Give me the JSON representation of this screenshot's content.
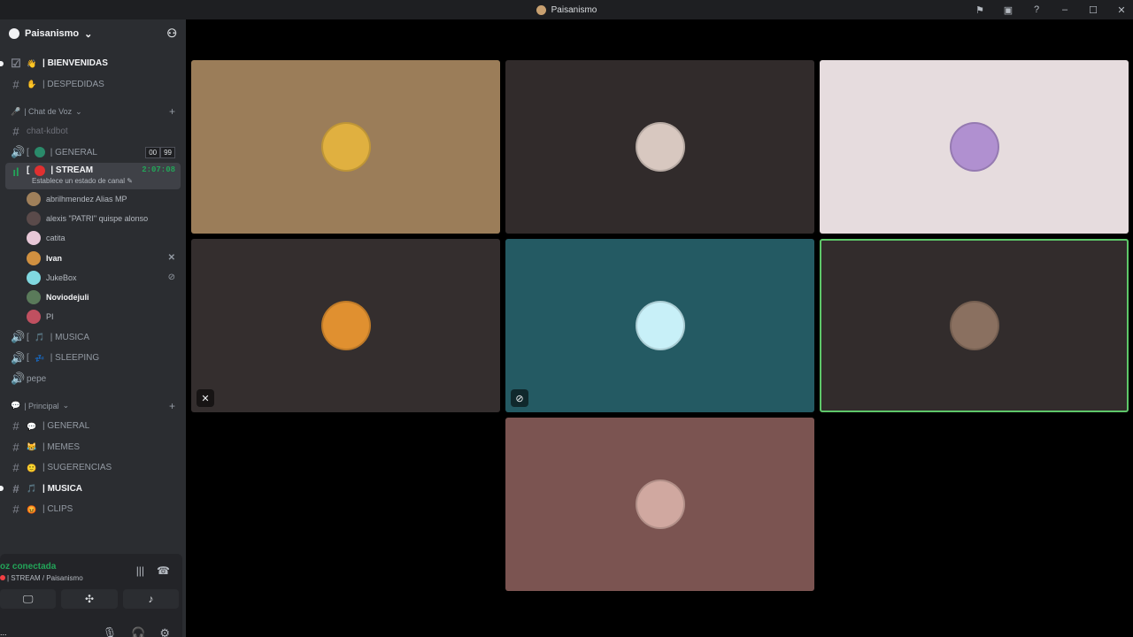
{
  "window": {
    "title": "Paisanismo"
  },
  "titlebar_icons": [
    "flag-icon",
    "inbox-icon",
    "help-icon",
    "minimize-icon",
    "maximize-icon",
    "close-icon"
  ],
  "titlebar_glyphs": [
    "⚑",
    "▣",
    "?",
    "–",
    "☐",
    "✕"
  ],
  "server": {
    "name": "Paisanismo",
    "chevron": "⌄",
    "invite_glyph": "⚇"
  },
  "top_channels": [
    {
      "label": "| BIENVENIDAS",
      "emoji": "👋",
      "bold": true,
      "unread": true,
      "icon": "☑"
    },
    {
      "label": "| DESPEDIDAS",
      "emoji": "✋",
      "bold": false,
      "unread": false,
      "icon": "#"
    }
  ],
  "voice_category": {
    "label": "| Chat de Voz",
    "plus": "+"
  },
  "voice_channels_top": [
    {
      "label": "chat-kdbot",
      "icon": "#",
      "dim": true
    }
  ],
  "general_voice": {
    "prefix": "[",
    "label": "| GENERAL",
    "badges": [
      "00",
      "99"
    ]
  },
  "stream_channel": {
    "prefix": "[",
    "label": "| STREAM",
    "timer": "2:07:08",
    "status": "Establece un estado de canal"
  },
  "members": [
    {
      "name": "abrilhmendez Alias MP",
      "color": "#a0805a",
      "strong": false,
      "icon": ""
    },
    {
      "name": "alexis \"PATRI\" quispe alonso",
      "color": "#5a4a4a",
      "strong": false,
      "icon": ""
    },
    {
      "name": "catita",
      "color": "#e8c8d8",
      "strong": false,
      "icon": ""
    },
    {
      "name": "Ivan",
      "color": "#d09040",
      "strong": true,
      "icon": "✕"
    },
    {
      "name": "JukeBox",
      "color": "#80d8e0",
      "strong": false,
      "icon": "⊘"
    },
    {
      "name": "Noviodejuli",
      "color": "#5a7a5a",
      "strong": true,
      "icon": ""
    },
    {
      "name": "PI",
      "color": "#c05060",
      "strong": false,
      "icon": ""
    }
  ],
  "voice_channels_bottom": [
    {
      "prefix": "[",
      "label": "| MUSICA",
      "emoji": "🎵"
    },
    {
      "prefix": "[",
      "label": "| SLEEPING",
      "emoji": "💤"
    },
    {
      "prefix": "",
      "label": "pepe",
      "emoji": ""
    }
  ],
  "principal_category": {
    "label": "| Principal",
    "plus": "+"
  },
  "text_channels": [
    {
      "label": "| GENERAL",
      "emoji": "💬",
      "bold": false,
      "unread": false
    },
    {
      "label": "| MEMES",
      "emoji": "😹",
      "bold": false,
      "unread": false
    },
    {
      "label": "| SUGERENCIAS",
      "emoji": "🙂",
      "bold": false,
      "unread": false
    },
    {
      "label": "| MUSICA",
      "emoji": "🎵",
      "bold": true,
      "unread": true
    },
    {
      "label": "| CLIPS",
      "emoji": "😡",
      "bold": false,
      "unread": false
    }
  ],
  "voice_panel": {
    "status": "oz conectada",
    "sub": "| STREAM / Paisanismo",
    "icons": [
      "waveform-icon",
      "disconnect-icon"
    ],
    "icon_glyphs": [
      "|||",
      "☎"
    ],
    "buttons": [
      "screen-share-icon",
      "activities-icon",
      "soundboard-icon"
    ],
    "button_glyphs": [
      "🖵",
      "✣",
      "♪"
    ]
  },
  "user_panel": {
    "name": "...",
    "status": "visible",
    "icons": [
      "microphone-icon",
      "headphones-icon",
      "settings-icon"
    ],
    "icon_glyphs": [
      "🎙",
      "🎧",
      "⚙"
    ]
  },
  "tiles": [
    {
      "bg": "#9b7d59",
      "avatar": "#e0b040",
      "speaking": false,
      "badge": ""
    },
    {
      "bg": "#312b2b",
      "avatar": "#d8c8c0",
      "speaking": false,
      "badge": ""
    },
    {
      "bg": "#e6dcde",
      "avatar": "#b090d0",
      "speaking": false,
      "badge": ""
    },
    {
      "bg": "#342e2e",
      "avatar": "#e09030",
      "speaking": false,
      "badge": "✕"
    },
    {
      "bg": "#245a63",
      "avatar": "#c8f0f8",
      "speaking": false,
      "badge": "⊘"
    },
    {
      "bg": "#322c2c",
      "avatar": "#8a7060",
      "speaking": true,
      "badge": ""
    },
    {
      "bg": "#7b5451",
      "avatar": "#d0a8a0",
      "speaking": false,
      "badge": ""
    }
  ]
}
